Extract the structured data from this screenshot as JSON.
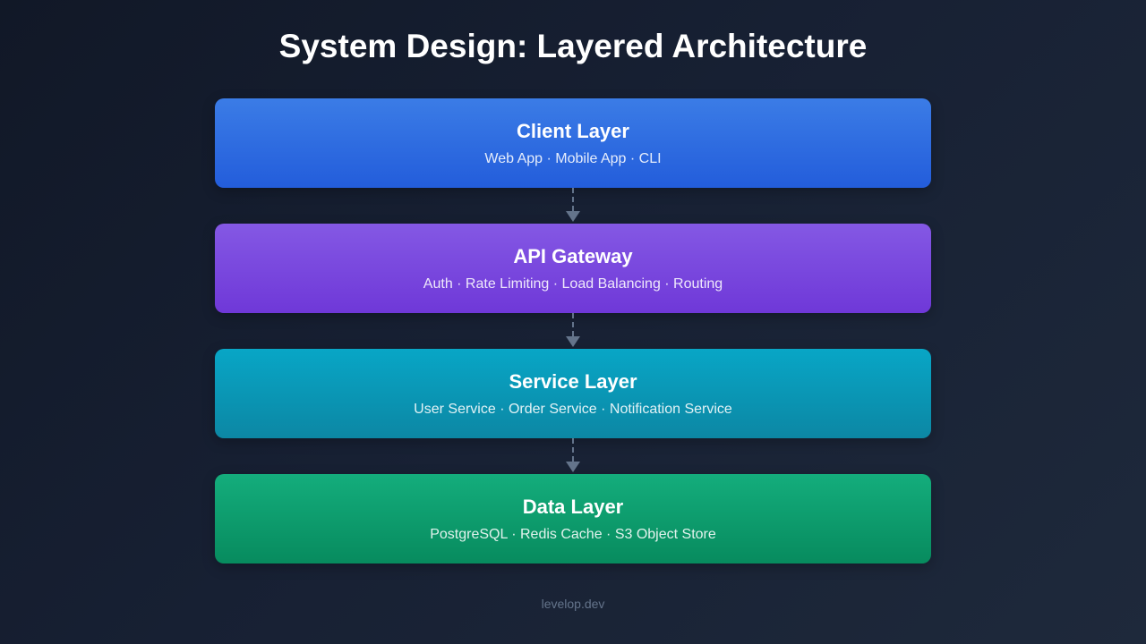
{
  "title": "System Design: Layered Architecture",
  "layers": [
    {
      "name": "Client Layer",
      "description": "Web App · Mobile App · CLI",
      "color_top": "#3b7ce6",
      "color_bottom": "#235ddb"
    },
    {
      "name": "API Gateway",
      "description": "Auth · Rate Limiting · Load Balancing · Routing",
      "color_top": "#8458e4",
      "color_bottom": "#6f38d8"
    },
    {
      "name": "Service Layer",
      "description": "User Service · Order Service · Notification Service",
      "color_top": "#08a6c6",
      "color_bottom": "#0c87a4"
    },
    {
      "name": "Data Layer",
      "description": "PostgreSQL · Redis Cache · S3 Object Store",
      "color_top": "#14ad7c",
      "color_bottom": "#078b5e"
    }
  ],
  "connector_color": "#64748b",
  "footer": "levelop.dev"
}
